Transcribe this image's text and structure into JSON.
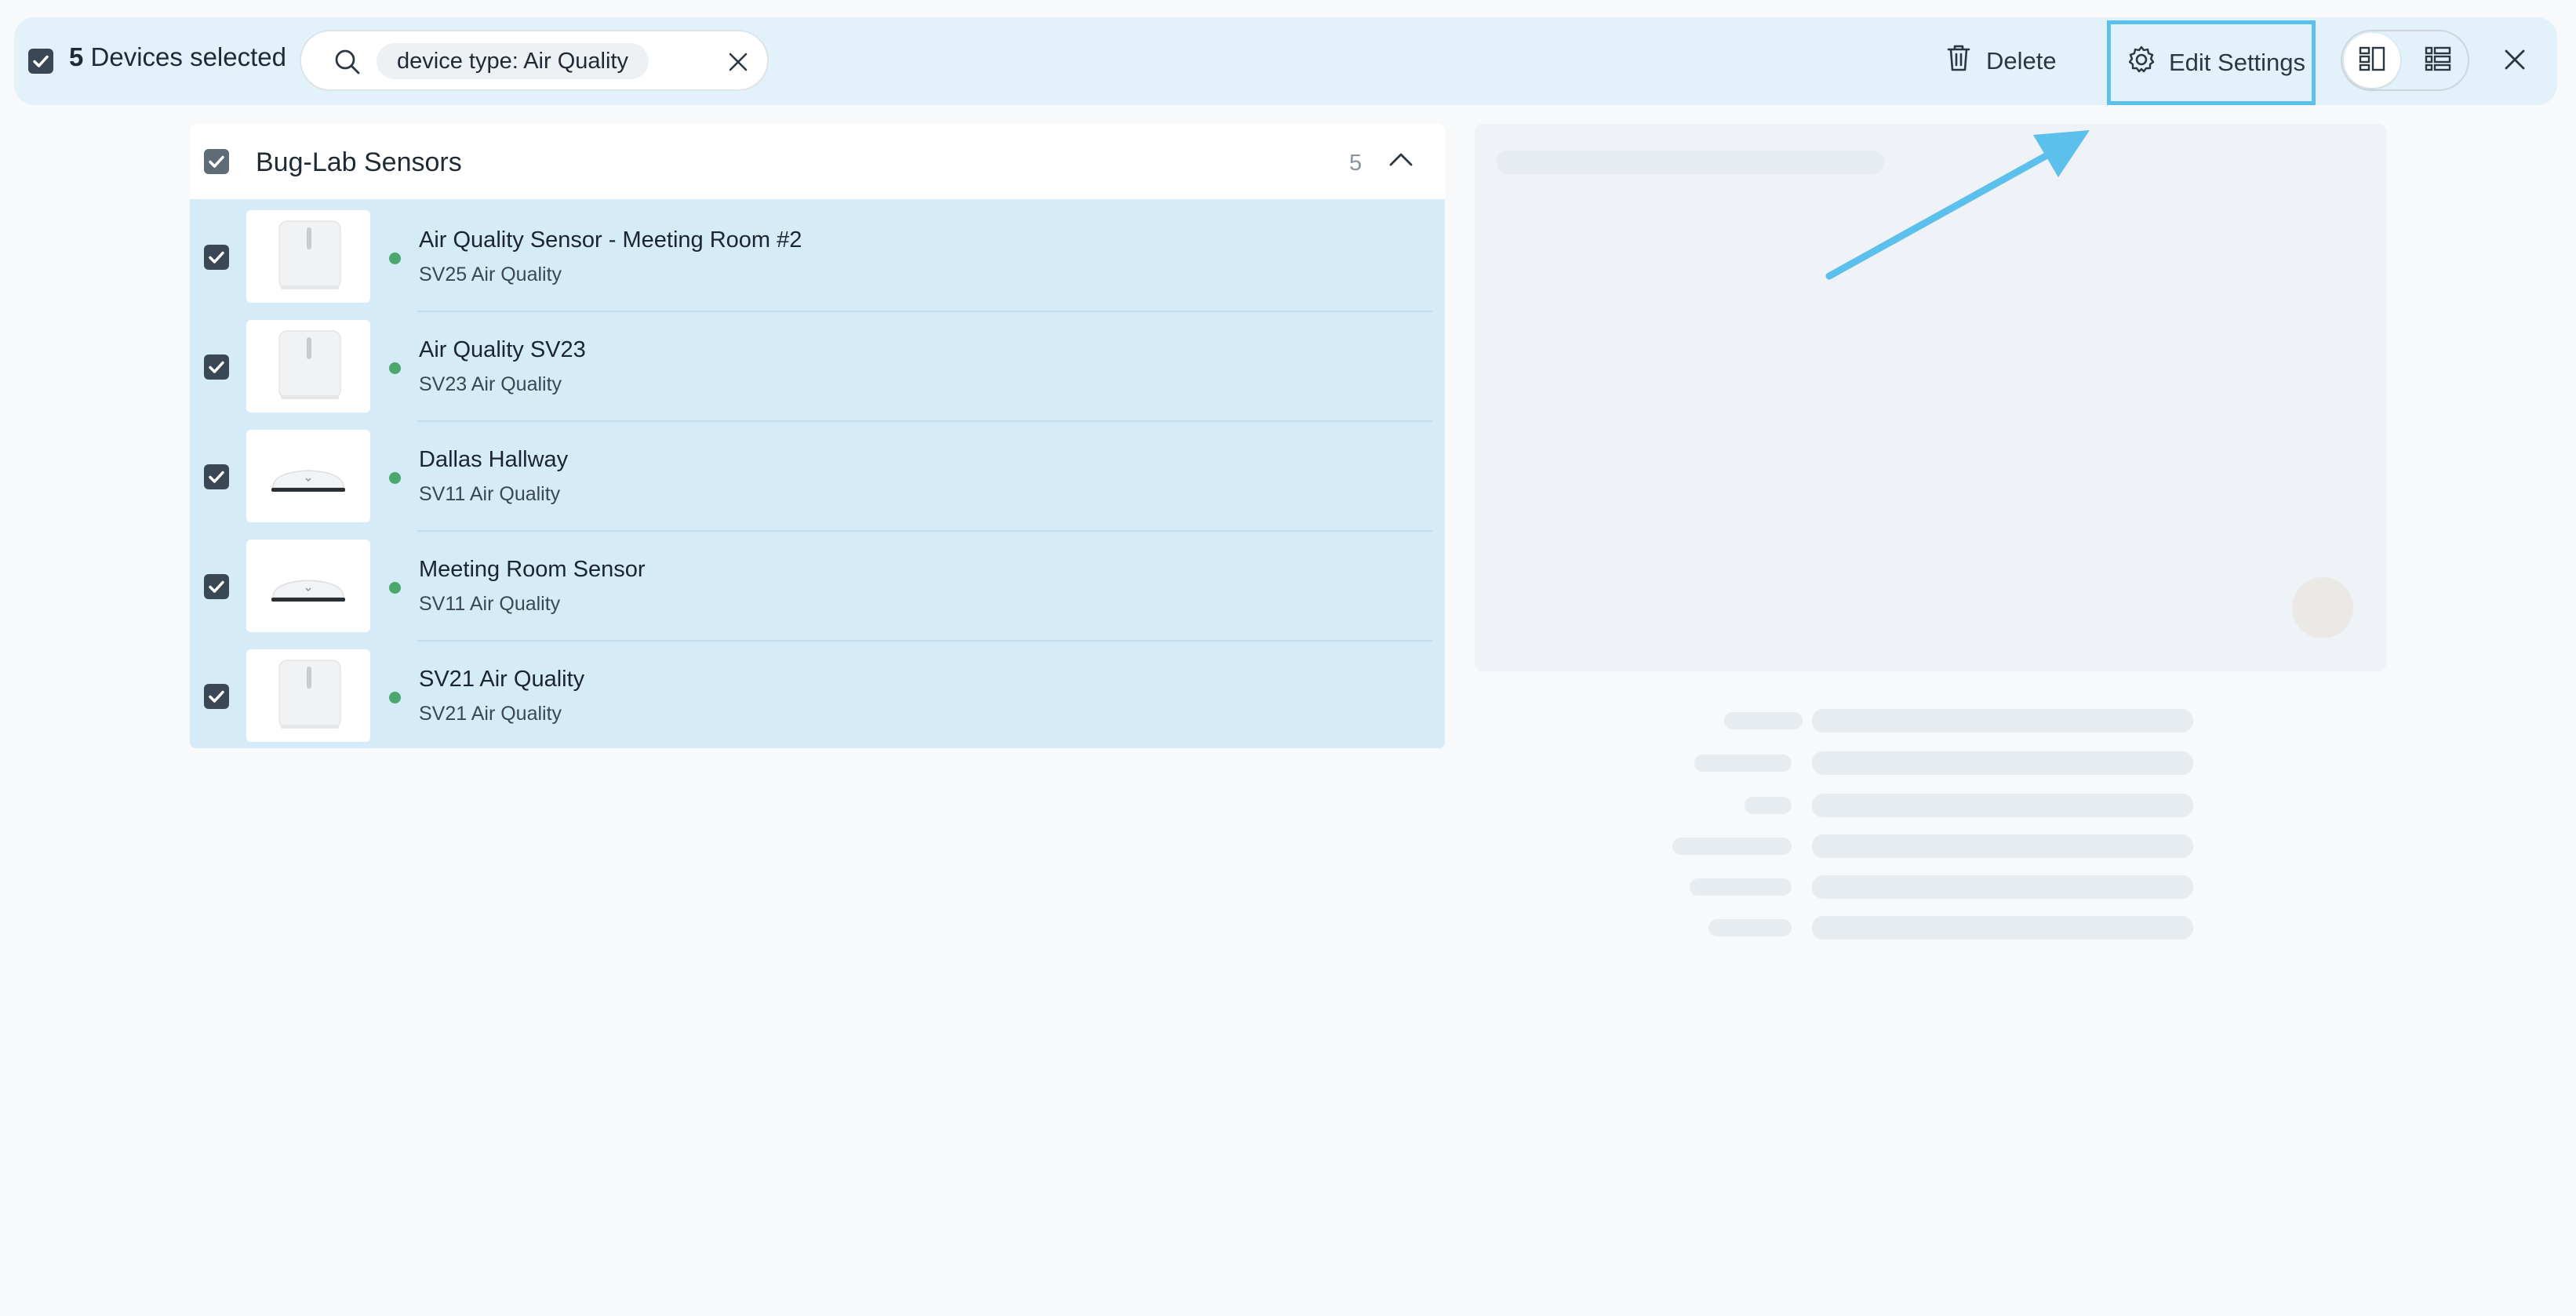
{
  "toolbar": {
    "selected_count": "5",
    "selected_label": "Devices selected",
    "search_chip": "device type: Air Quality",
    "delete_label": "Delete",
    "edit_settings_label": "Edit Settings"
  },
  "group": {
    "title": "Bug-Lab Sensors",
    "count": "5"
  },
  "devices": [
    {
      "name": "Air Quality Sensor - Meeting Room #2",
      "type": "SV25 Air Quality",
      "status_color": "#4aa86d",
      "icon": "wall-sensor-icon"
    },
    {
      "name": "Air Quality SV23",
      "type": "SV23 Air Quality",
      "status_color": "#4aa86d",
      "icon": "wall-sensor-icon"
    },
    {
      "name": "Dallas Hallway",
      "type": "SV11 Air Quality",
      "status_color": "#4aa86d",
      "icon": "ceiling-sensor-icon"
    },
    {
      "name": "Meeting Room Sensor",
      "type": "SV11 Air Quality",
      "status_color": "#4aa86d",
      "icon": "ceiling-sensor-icon"
    },
    {
      "name": "SV21 Air Quality",
      "type": "SV21 Air Quality",
      "status_color": "#4aa86d",
      "icon": "wall-sensor-icon"
    }
  ],
  "colors": {
    "accent_highlight": "#5bc0ec",
    "selected_row_bg": "#d5ebf8",
    "toolbar_bg": "#e3f1fa"
  }
}
